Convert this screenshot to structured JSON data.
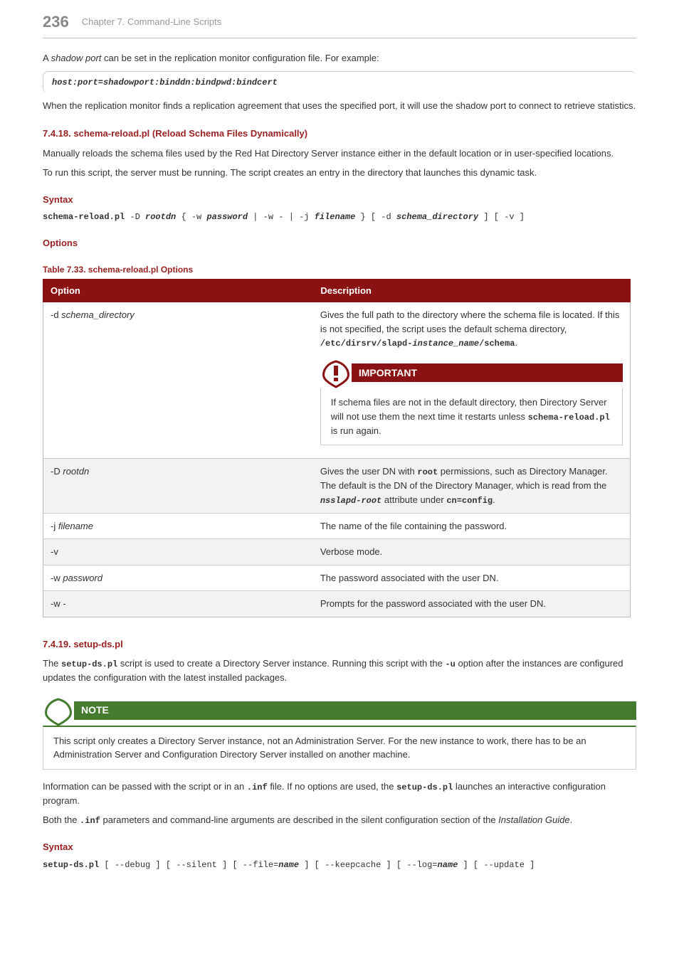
{
  "header": {
    "page_number": "236",
    "chapter": "Chapter 7. Command-Line Scripts"
  },
  "intro": {
    "p1_a": "A ",
    "p1_b": "shadow port",
    "p1_c": " can be set in the replication monitor configuration file. For example:",
    "code1": "host:port=shadowport:binddn:bindpwd:bindcert",
    "p2": "When the replication monitor finds a replication agreement that uses the specified port, it will use the shadow port to connect to retrieve statistics."
  },
  "sec_7_4_18": {
    "title": "7.4.18. schema-reload.pl (Reload Schema Files Dynamically)",
    "p1": "Manually reloads the schema files used by the Red Hat Directory Server instance either in the default location or in user-specified locations.",
    "p2": "To run this script, the server must be running. The script creates an entry in the directory that launches this dynamic task.",
    "syntax_h": "Syntax",
    "syntax": {
      "cmd": "schema-reload.pl",
      "t1": " -D ",
      "a1": "rootdn",
      "t2": " { -w ",
      "a2": "password",
      "t3": " | -w - | -j ",
      "a3": "filename",
      "t4": " } [ -d ",
      "a4": "schema_directory",
      "t5": " ] [ -v ]"
    },
    "options_h": "Options",
    "table_caption": "Table 7.33. schema-reload.pl Options",
    "th_option": "Option",
    "th_desc": "Description",
    "rows": {
      "r0": {
        "opt_pre": "-d ",
        "opt_it": "schema_directory",
        "desc_a": "Gives the full path to the directory where the schema file is located. If this is not specified, the script uses the default schema directory, ",
        "desc_code_a": "/etc/dirsrv/slapd-",
        "desc_code_b": "instance_name",
        "desc_code_c": "/schema",
        "desc_dot": ".",
        "imp_title": "IMPORTANT",
        "imp_body_a": "If schema files are not in the default directory, then Directory Server will not use them the next time it restarts unless ",
        "imp_code": "schema-reload.pl",
        "imp_body_b": " is run again."
      },
      "r1": {
        "opt_pre": "-D ",
        "opt_it": "rootdn",
        "desc_a": "Gives the user DN with ",
        "desc_code1": "root",
        "desc_b": " permissions, such as Directory Manager. The default is the DN of the Directory Manager, which is read from the ",
        "desc_code2": "nsslapd-root",
        "desc_c": " attribute under ",
        "desc_code3": "cn=config",
        "desc_d": "."
      },
      "r2": {
        "opt_pre": "-j ",
        "opt_it": "filename",
        "desc": "The name of the file containing the password."
      },
      "r3": {
        "opt": "-v",
        "desc": "Verbose mode."
      },
      "r4": {
        "opt_pre": "-w ",
        "opt_it": "password",
        "desc": "The password associated with the user DN."
      },
      "r5": {
        "opt": "-w -",
        "desc": "Prompts for the password associated with the user DN."
      }
    }
  },
  "sec_7_4_19": {
    "title": "7.4.19. setup-ds.pl",
    "p1_a": "The ",
    "p1_code1": "setup-ds.pl",
    "p1_b": " script is used to create a Directory Server instance. Running this script with the ",
    "p1_code2": "-u",
    "p1_c": " option after the instances are configured updates the configuration with the latest installed packages.",
    "note_title": "NOTE",
    "note_body": "This script only creates a Directory Server instance, not an Administration Server. For the new instance to work, there has to be an Administration Server and Configuration Directory Server installed on another machine.",
    "p2_a": "Information can be passed with the script or in an ",
    "p2_code1": ".inf",
    "p2_b": " file. If no options are used, the ",
    "p2_code2": "setup-ds.pl",
    "p2_c": " launches an interactive configuration program.",
    "p3_a": "Both the ",
    "p3_code": ".inf",
    "p3_b": " parameters and command-line arguments are described in the silent configuration section of the ",
    "p3_it": "Installation Guide",
    "p3_c": ".",
    "syntax_h": "Syntax",
    "syntax": {
      "cmd": "setup-ds.pl",
      "t1": " [ --debug ] [ --silent ] [ --file=",
      "a1": "name",
      "t2": " ] [ --keepcache ] [ --log=",
      "a2": "name",
      "t3": " ] [ --update ]"
    }
  }
}
